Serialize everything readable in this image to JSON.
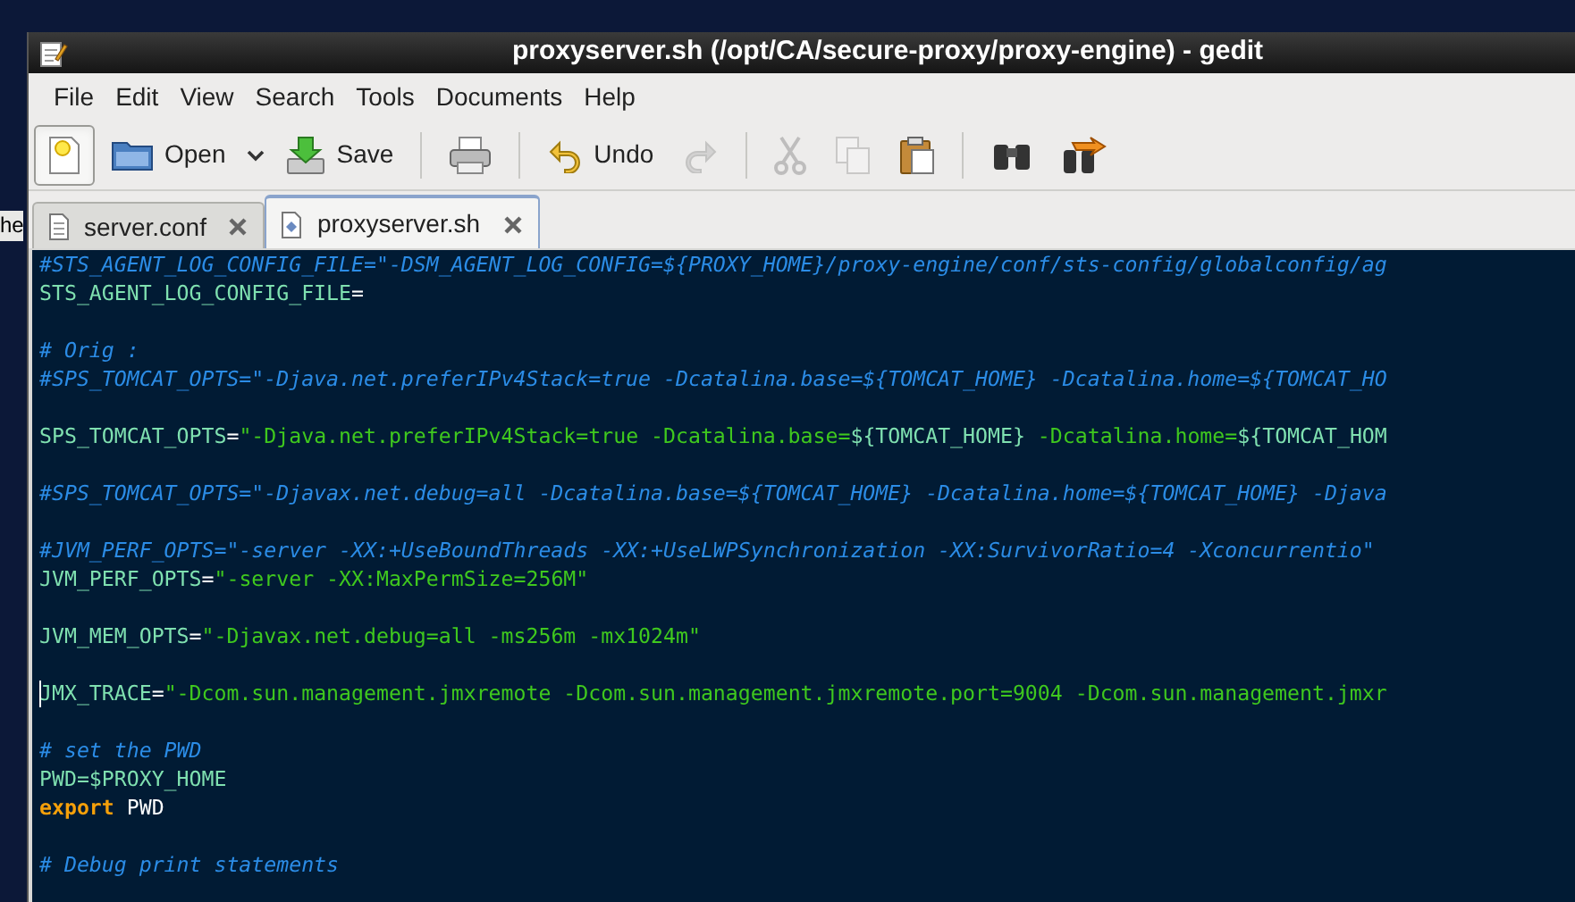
{
  "desktop": {
    "label": "he"
  },
  "window": {
    "title": "proxyserver.sh (/opt/CA/secure-proxy/proxy-engine) - gedit"
  },
  "menu": [
    "File",
    "Edit",
    "View",
    "Search",
    "Tools",
    "Documents",
    "Help"
  ],
  "toolbar": [
    {
      "kind": "new",
      "pressed": true,
      "disabled": false
    },
    {
      "kind": "open",
      "label": "Open",
      "pressed": false,
      "disabled": false
    },
    {
      "kind": "dropdown",
      "pressed": false,
      "disabled": false
    },
    {
      "kind": "save",
      "label": "Save",
      "pressed": false,
      "disabled": false
    },
    {
      "kind": "separator"
    },
    {
      "kind": "print",
      "pressed": false,
      "disabled": false
    },
    {
      "kind": "separator"
    },
    {
      "kind": "undo",
      "label": "Undo",
      "pressed": false,
      "disabled": false
    },
    {
      "kind": "redo",
      "pressed": false,
      "disabled": true
    },
    {
      "kind": "separator"
    },
    {
      "kind": "cut",
      "pressed": false,
      "disabled": true
    },
    {
      "kind": "copy",
      "pressed": false,
      "disabled": true
    },
    {
      "kind": "paste",
      "pressed": false,
      "disabled": false
    },
    {
      "kind": "separator"
    },
    {
      "kind": "find",
      "pressed": false,
      "disabled": false
    },
    {
      "kind": "replace",
      "pressed": false,
      "disabled": false
    }
  ],
  "tabs": [
    {
      "label": "server.conf",
      "selected": false
    },
    {
      "label": "proxyserver.sh",
      "selected": true
    }
  ],
  "editor": {
    "lines": [
      {
        "kind": "code",
        "cursor": false,
        "segments": [
          {
            "kind": "comment",
            "text": "#STS_AGENT_LOG_CONFIG_FILE=\"-DSM_AGENT_LOG_CONFIG=${PROXY_HOME}/proxy-engine/conf/sts-config/globalconfig/ag"
          }
        ]
      },
      {
        "kind": "code",
        "cursor": false,
        "segments": [
          {
            "kind": "variable",
            "text": "STS_AGENT_LOG_CONFIG_FILE"
          },
          {
            "kind": "plain",
            "text": "="
          }
        ]
      },
      {
        "kind": "blank"
      },
      {
        "kind": "code",
        "cursor": false,
        "segments": [
          {
            "kind": "comment",
            "text": "# Orig :"
          }
        ]
      },
      {
        "kind": "code",
        "cursor": false,
        "segments": [
          {
            "kind": "comment",
            "text": "#SPS_TOMCAT_OPTS=\"-Djava.net.preferIPv4Stack=true -Dcatalina.base=${TOMCAT_HOME} -Dcatalina.home=${TOMCAT_HO"
          }
        ]
      },
      {
        "kind": "blank"
      },
      {
        "kind": "code",
        "cursor": false,
        "segments": [
          {
            "kind": "variable",
            "text": "SPS_TOMCAT_OPTS"
          },
          {
            "kind": "plain",
            "text": "="
          },
          {
            "kind": "string",
            "text": "\"-Djava.net.preferIPv4Stack=true -Dcatalina.base="
          },
          {
            "kind": "variable",
            "text": "${TOMCAT_HOME}"
          },
          {
            "kind": "string",
            "text": " -Dcatalina.home="
          },
          {
            "kind": "variable",
            "text": "${TOMCAT_HOM"
          }
        ]
      },
      {
        "kind": "blank"
      },
      {
        "kind": "code",
        "cursor": false,
        "segments": [
          {
            "kind": "comment",
            "text": "#SPS_TOMCAT_OPTS=\"-Djavax.net.debug=all -Dcatalina.base=${TOMCAT_HOME} -Dcatalina.home=${TOMCAT_HOME} -Djava"
          }
        ]
      },
      {
        "kind": "blank"
      },
      {
        "kind": "code",
        "cursor": false,
        "segments": [
          {
            "kind": "comment",
            "text": "#JVM_PERF_OPTS=\"-server -XX:+UseBoundThreads -XX:+UseLWPSynchronization -XX:SurvivorRatio=4 -Xconcurrentio\""
          }
        ]
      },
      {
        "kind": "code",
        "cursor": false,
        "segments": [
          {
            "kind": "variable",
            "text": "JVM_PERF_OPTS"
          },
          {
            "kind": "plain",
            "text": "="
          },
          {
            "kind": "string",
            "text": "\"-server -XX:MaxPermSize=256M\""
          }
        ]
      },
      {
        "kind": "blank"
      },
      {
        "kind": "code",
        "cursor": false,
        "segments": [
          {
            "kind": "variable",
            "text": "JVM_MEM_OPTS"
          },
          {
            "kind": "plain",
            "text": "="
          },
          {
            "kind": "string",
            "text": "\"-Djavax.net.debug=all -ms256m -mx1024m\""
          }
        ]
      },
      {
        "kind": "blank"
      },
      {
        "kind": "code",
        "cursor": true,
        "segments": [
          {
            "kind": "variable",
            "text": "JMX_TRACE"
          },
          {
            "kind": "plain",
            "text": "="
          },
          {
            "kind": "string",
            "text": "\"-Dcom.sun.management.jmxremote -Dcom.sun.management.jmxremote.port=9004 -Dcom.sun.management.jmxr"
          }
        ]
      },
      {
        "kind": "blank"
      },
      {
        "kind": "code",
        "cursor": false,
        "segments": [
          {
            "kind": "comment",
            "text": "# set the PWD"
          }
        ]
      },
      {
        "kind": "code",
        "cursor": false,
        "segments": [
          {
            "kind": "variable",
            "text": "PWD=$PROXY_HOME"
          }
        ]
      },
      {
        "kind": "code",
        "cursor": false,
        "segments": [
          {
            "kind": "keyword",
            "text": "export"
          },
          {
            "kind": "plain",
            "text": " PWD"
          }
        ]
      },
      {
        "kind": "blank"
      },
      {
        "kind": "code",
        "cursor": false,
        "segments": [
          {
            "kind": "comment",
            "text": "# Debug print statements"
          }
        ]
      }
    ]
  }
}
